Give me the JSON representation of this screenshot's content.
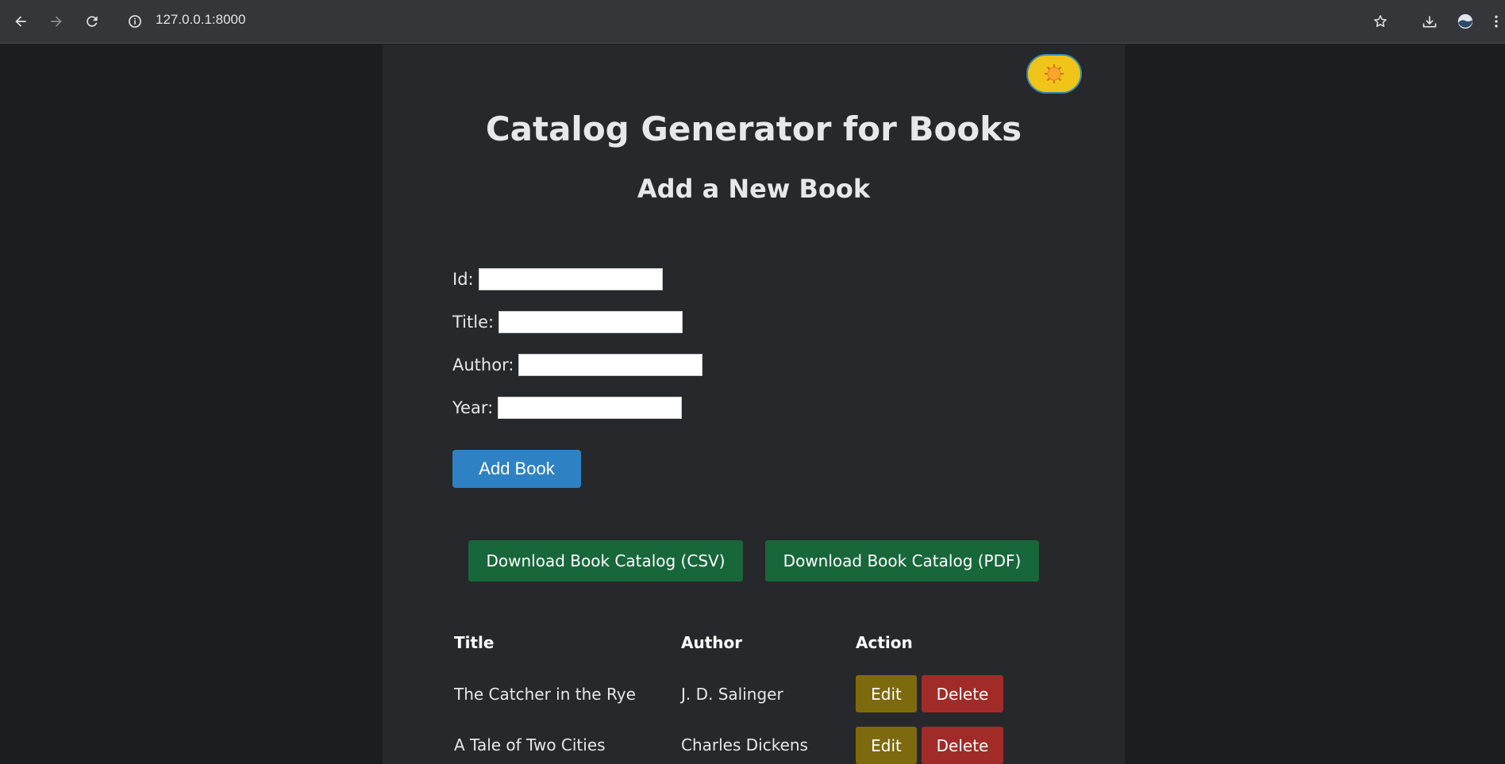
{
  "browser": {
    "url": "127.0.0.1:8000"
  },
  "page": {
    "title": "Catalog Generator for Books",
    "form_title": "Add a New Book",
    "fields": [
      {
        "label": "Id:",
        "value": ""
      },
      {
        "label": "Title:",
        "value": ""
      },
      {
        "label": "Author:",
        "value": ""
      },
      {
        "label": "Year:",
        "value": ""
      }
    ],
    "add_button": "Add Book",
    "download_csv": "Download Book Catalog (CSV)",
    "download_pdf": "Download Book Catalog (PDF)"
  },
  "table": {
    "headers": [
      "Title",
      "Author",
      "Action"
    ],
    "rows": [
      {
        "title": "The Catcher in the Rye",
        "author": "J. D. Salinger",
        "edit": "Edit",
        "delete": "Delete"
      },
      {
        "title": "A Tale of Two Cities",
        "author": "Charles Dickens",
        "edit": "Edit",
        "delete": "Delete"
      }
    ]
  },
  "colors": {
    "accent_blue": "#2e82c4",
    "download_green": "#17673a",
    "edit_olive": "#7d6a0f",
    "delete_red": "#a12b28",
    "toggle_yellow": "#f0c419"
  },
  "icons": {
    "back": "back-arrow-icon",
    "forward": "forward-arrow-icon",
    "reload": "reload-icon",
    "site_info": "info-icon",
    "bookmark": "star-icon",
    "download": "download-icon",
    "profile": "avatar",
    "menu": "more-vert-icon",
    "theme": "sun-icon"
  }
}
